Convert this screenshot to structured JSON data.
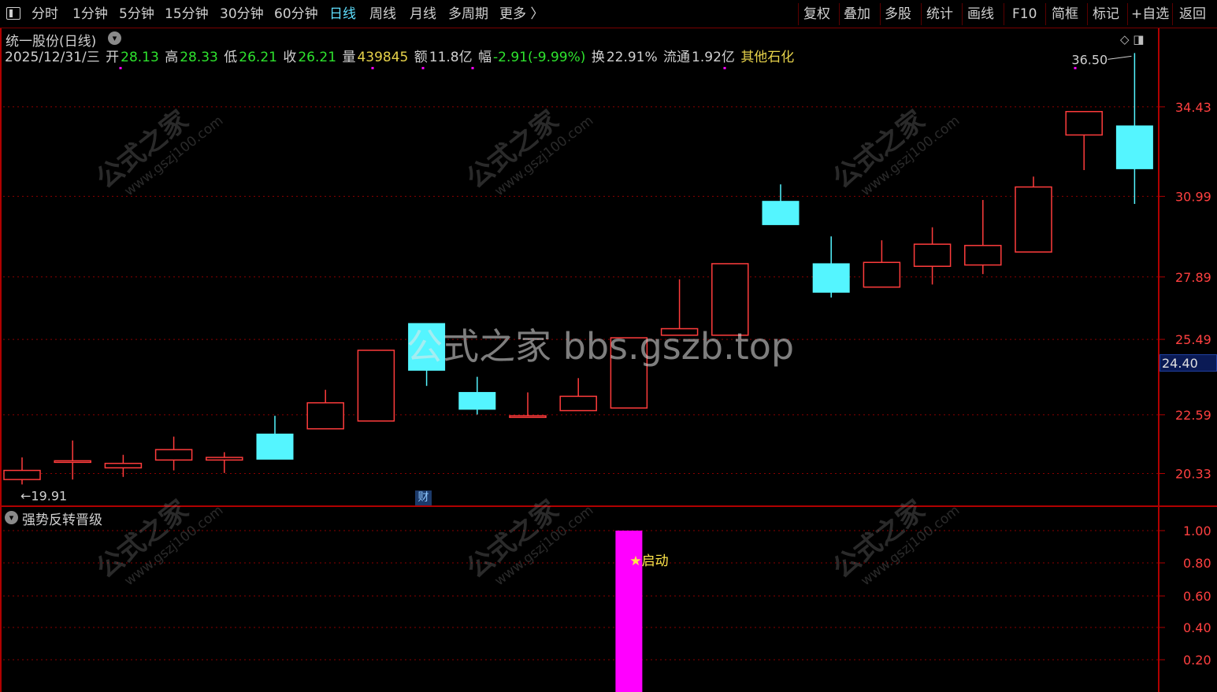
{
  "toolbar": {
    "left_items": [
      {
        "label": "分时",
        "active": false
      },
      {
        "label": "1分钟",
        "active": false
      },
      {
        "label": "5分钟",
        "active": false
      },
      {
        "label": "15分钟",
        "active": false
      },
      {
        "label": "30分钟",
        "active": false
      },
      {
        "label": "60分钟",
        "active": false
      },
      {
        "label": "日线",
        "active": true
      },
      {
        "label": "周线",
        "active": false
      },
      {
        "label": "月线",
        "active": false
      },
      {
        "label": "多周期",
        "active": false
      },
      {
        "label": "更多 〉",
        "active": false
      }
    ],
    "right_items": [
      "复权",
      "叠加",
      "多股",
      "统计",
      "画线",
      "F10",
      "简框",
      "标记",
      "+自选",
      "返回"
    ]
  },
  "stock": {
    "title": "统一股份(日线)",
    "date": "2025/12/31/三",
    "open_label": "开",
    "open": "28.13",
    "high_label": "高",
    "high": "28.33",
    "low_label": "低",
    "low": "26.21",
    "close_label": "收",
    "close": "26.21",
    "volume_label": "量",
    "volume": "439845",
    "amount_label": "额",
    "amount": "11.8亿",
    "change_label": "幅",
    "change": "-2.91(-9.99%)",
    "turnover_label": "换",
    "turnover": "22.91%",
    "float_label": "流通",
    "float": "1.92亿",
    "sector": "其他石化"
  },
  "chart_data": {
    "type": "candlestick",
    "y_ticks": [
      20.33,
      22.59,
      25.49,
      27.89,
      30.99,
      34.43
    ],
    "y_tick_labels": [
      "20.33",
      "22.59",
      "25.49",
      "27.89",
      "30.99",
      "34.43"
    ],
    "current_price": "24.40",
    "max_label": "36.50",
    "min_label": "19.91",
    "candles": [
      {
        "o": 20.1,
        "c": 20.45,
        "h": 20.95,
        "l": 19.91
      },
      {
        "o": 20.82,
        "c": 20.82,
        "h": 21.6,
        "l": 20.1
      },
      {
        "o": 20.55,
        "c": 20.72,
        "h": 21.05,
        "l": 20.2
      },
      {
        "o": 20.85,
        "c": 21.25,
        "h": 21.75,
        "l": 20.45
      },
      {
        "o": 20.85,
        "c": 20.95,
        "h": 21.15,
        "l": 20.35
      },
      {
        "o": 21.85,
        "c": 20.88,
        "h": 22.55,
        "l": 20.88
      },
      {
        "o": 22.05,
        "c": 23.05,
        "h": 23.55,
        "l": 22.05
      },
      {
        "o": 22.35,
        "c": 25.07,
        "h": 25.07,
        "l": 22.35
      },
      {
        "o": 26.1,
        "c": 24.3,
        "h": 26.1,
        "l": 23.7
      },
      {
        "o": 23.45,
        "c": 22.8,
        "h": 24.05,
        "l": 22.6
      },
      {
        "o": 22.55,
        "c": 22.55,
        "h": 23.45,
        "l": 22.55
      },
      {
        "o": 22.75,
        "c": 23.3,
        "h": 24.0,
        "l": 22.75
      },
      {
        "o": 22.85,
        "c": 25.55,
        "h": 25.55,
        "l": 22.85
      },
      {
        "o": 25.65,
        "c": 25.9,
        "h": 27.8,
        "l": 25.65
      },
      {
        "o": 25.65,
        "c": 28.4,
        "h": 28.4,
        "l": 25.65
      },
      {
        "o": 30.8,
        "c": 29.9,
        "h": 31.45,
        "l": 29.9
      },
      {
        "o": 28.4,
        "c": 27.3,
        "h": 29.45,
        "l": 27.1
      },
      {
        "o": 27.5,
        "c": 28.45,
        "h": 29.3,
        "l": 27.5
      },
      {
        "o": 28.3,
        "c": 29.15,
        "h": 29.8,
        "l": 27.6
      },
      {
        "o": 28.35,
        "c": 29.1,
        "h": 30.85,
        "l": 28.0
      },
      {
        "o": 28.85,
        "c": 31.35,
        "h": 31.75,
        "l": 28.85
      },
      {
        "o": 33.35,
        "c": 34.25,
        "h": 34.25,
        "l": 32.0
      },
      {
        "o": 33.7,
        "c": 32.05,
        "h": 36.5,
        "l": 30.7
      }
    ]
  },
  "indicator": {
    "title": "强势反转晋级",
    "y_ticks": [
      "1.00",
      "0.80",
      "0.60",
      "0.40",
      "0.20"
    ],
    "signal_label": "★启动",
    "signal_value": 1.0,
    "signal_index": 12
  },
  "badges": {
    "cai": "财"
  },
  "watermark": {
    "main": "公式之家 bbs.gszb.top",
    "diag_cn": "公式之家",
    "diag_url": "www.gszj100.com"
  },
  "colors": {
    "up": "#ff3c3c",
    "down": "#54f5ff",
    "grid": "#8a0000",
    "axis": "#b00000",
    "signal": "#ff00ff",
    "active_tab": "#5fe0ff"
  }
}
